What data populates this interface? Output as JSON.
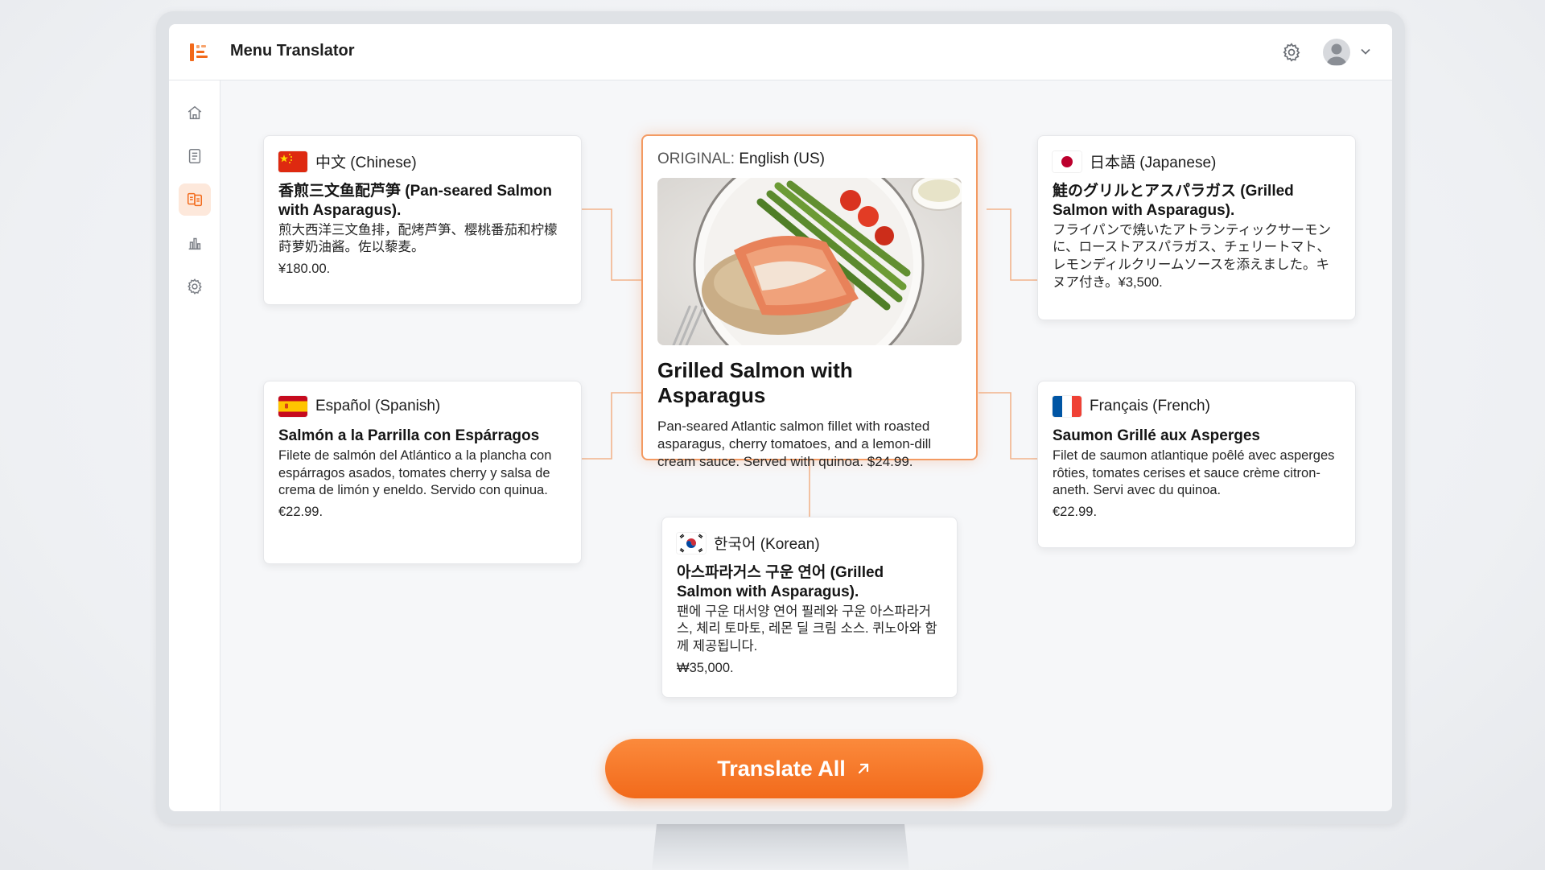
{
  "app": {
    "title": "Menu Translator"
  },
  "colors": {
    "accent": "#f26a1b",
    "accent_light": "#fde8db",
    "original_border": "#f39a62"
  },
  "sidebar": {
    "items": [
      {
        "icon": "home-icon",
        "active": false
      },
      {
        "icon": "document-icon",
        "active": false
      },
      {
        "icon": "translate-icon",
        "active": true
      },
      {
        "icon": "bar-chart-icon",
        "active": false
      },
      {
        "icon": "gear-icon",
        "active": false
      }
    ]
  },
  "header": {
    "settings_icon": "gear-icon",
    "avatar_icon": "user-avatar-icon",
    "menu_icon": "chevron-down-icon"
  },
  "original": {
    "label_prefix": "ORIGINAL:",
    "language": "English (US)",
    "title": "Grilled Salmon with Asparagus",
    "description": "Pan-seared Atlantic salmon fillet with roasted asparagus, cherry tomatoes, and a lemon-dill cream sauce. Served with quinoa. $24.99."
  },
  "translations": {
    "chinese": {
      "language": "中文 (Chinese)",
      "title": "香煎三文鱼配芦笋 (Pan-seared Salmon with Asparagus).",
      "description": "煎大西洋三文鱼排，配烤芦笋、樱桃番茄和柠檬莳萝奶油酱。佐以藜麦。",
      "price": "¥180.00."
    },
    "japanese": {
      "language": "日本語 (Japanese)",
      "title": "鮭のグリルとアスパラガス (Grilled Salmon with Asparagus).",
      "description": "フライパンで焼いたアトランティックサーモンに、ローストアスパラガス、チェリートマト、レモンディルクリームソースを添えました。キヌア付き。¥3,500."
    },
    "spanish": {
      "language": "Español (Spanish)",
      "title": "Salmón a la Parrilla con Espárragos",
      "description": "Filete de salmón del Atlántico a la plancha con espárragos asados, tomates cherry y salsa de crema de limón y eneldo. Servido con quinua.",
      "price": "€22.99."
    },
    "french": {
      "language": "Français (French)",
      "title": "Saumon Grillé aux Asperges",
      "description": "Filet de saumon atlantique poêlé avec asperges rôties, tomates cerises et sauce crème citron-aneth. Servi avec du quinoa.",
      "price": "€22.99."
    },
    "korean": {
      "language": "한국어 (Korean)",
      "title": "아스파라거스 구운 연어 (Grilled Salmon with Asparagus).",
      "description": "팬에 구운 대서양 연어 필레와 구운 아스파라거스, 체리 토마토, 레몬 딜 크림 소스. 퀴노아와 함께 제공됩니다.",
      "price": "₩35,000."
    }
  },
  "actions": {
    "translate_all_label": "Translate All",
    "translate_all_icon": "arrow-up-right-icon"
  }
}
